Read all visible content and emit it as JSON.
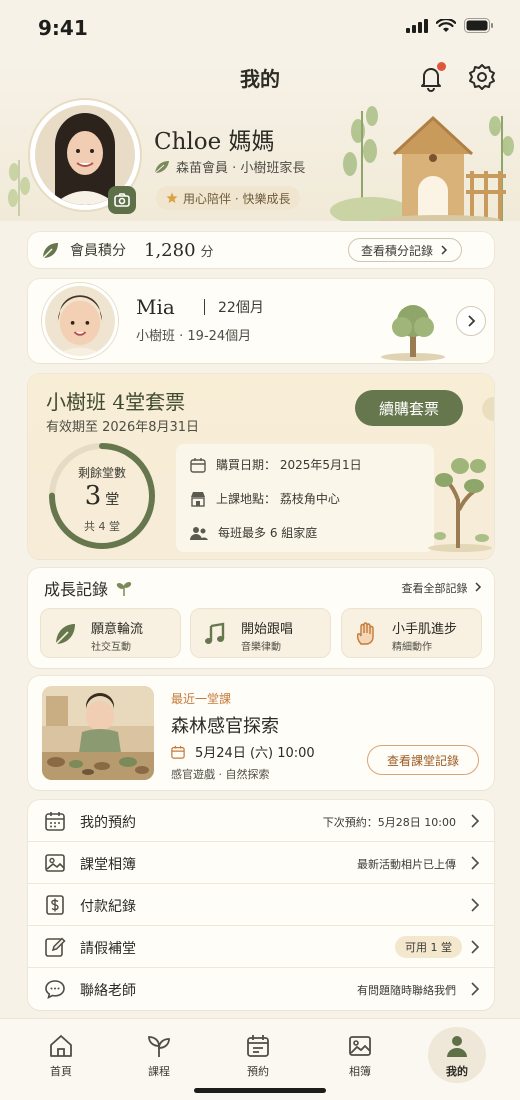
{
  "status_bar": {
    "time": "9:41"
  },
  "header": {
    "title": "我的"
  },
  "profile": {
    "name": "Chloe 媽媽",
    "role": "森苗會員 · 小樹班家長",
    "tag": "用心陪伴 · 快樂成長"
  },
  "points": {
    "label": "會員積分",
    "value": "1,280",
    "unit": "分",
    "button": "查看積分記錄"
  },
  "child": {
    "name": "Mia",
    "age": "22個月",
    "class": "小樹班 · 19-24個月"
  },
  "package": {
    "title": "小樹班 4堂套票",
    "expiry": "有效期至 2026年8月31日",
    "renew_label": "續購套票",
    "remaining_label": "剩餘堂數",
    "remaining": "3",
    "remaining_unit": "堂",
    "total": "共 4 堂",
    "remaining_fraction": 0.75,
    "purchase_date": "購買日期： 2025年5月1日",
    "location": "上課地點： 荔枝角中心",
    "capacity": "每班最多 6 組家庭"
  },
  "growth": {
    "title": "成長記錄",
    "see_all": "查看全部記錄",
    "items": [
      {
        "title": "願意輪流",
        "sub": "社交互動",
        "icon": "leaf-icon"
      },
      {
        "title": "開始跟唱",
        "sub": "音樂律動",
        "icon": "music-note-icon"
      },
      {
        "title": "小手肌進步",
        "sub": "精細動作",
        "icon": "hand-icon"
      }
    ]
  },
  "last_lesson": {
    "tag": "最近一堂課",
    "title": "森林感官探索",
    "date": "5月24日 (六) 10:00",
    "sub": "感官遊戲 · 自然探索",
    "button": "查看課堂記錄"
  },
  "menu": [
    {
      "label": "我的預約",
      "meta": "下次預約：5月28日 10:00",
      "icon": "calendar-icon"
    },
    {
      "label": "課堂相簿",
      "meta": "最新活動相片已上傳",
      "icon": "photo-icon"
    },
    {
      "label": "付款紀錄",
      "meta": "",
      "icon": "payment-icon"
    },
    {
      "label": "請假補堂",
      "meta": "可用 1 堂",
      "icon": "edit-icon"
    },
    {
      "label": "聯絡老師",
      "meta": "有問題隨時聯絡我們",
      "icon": "chat-icon"
    }
  ],
  "tabs": [
    {
      "label": "首頁",
      "icon": "home-icon"
    },
    {
      "label": "課程",
      "icon": "sprout-icon"
    },
    {
      "label": "預約",
      "icon": "calendar-icon"
    },
    {
      "label": "相簿",
      "icon": "photo-icon"
    },
    {
      "label": "我的",
      "icon": "person-icon",
      "active": true
    }
  ],
  "colors": {
    "brand_green": "#66764d",
    "accent_orange": "#c47a3a",
    "background": "#f7f2e8"
  }
}
